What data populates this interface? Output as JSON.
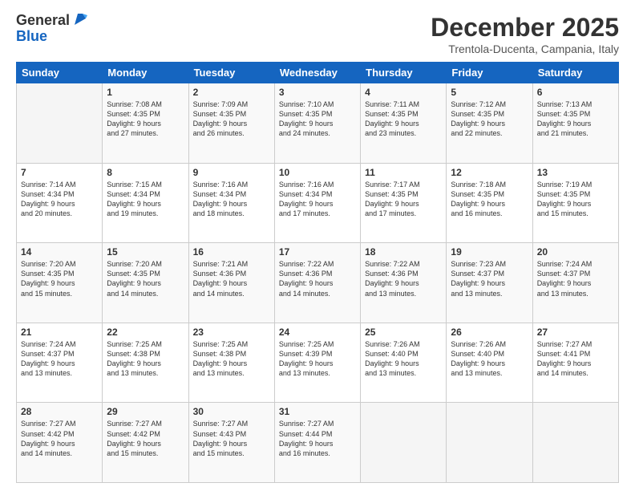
{
  "logo": {
    "general": "General",
    "blue": "Blue"
  },
  "title": "December 2025",
  "subtitle": "Trentola-Ducenta, Campania, Italy",
  "days": [
    "Sunday",
    "Monday",
    "Tuesday",
    "Wednesday",
    "Thursday",
    "Friday",
    "Saturday"
  ],
  "weeks": [
    [
      {
        "day": "",
        "content": ""
      },
      {
        "day": "1",
        "content": "Sunrise: 7:08 AM\nSunset: 4:35 PM\nDaylight: 9 hours\nand 27 minutes."
      },
      {
        "day": "2",
        "content": "Sunrise: 7:09 AM\nSunset: 4:35 PM\nDaylight: 9 hours\nand 26 minutes."
      },
      {
        "day": "3",
        "content": "Sunrise: 7:10 AM\nSunset: 4:35 PM\nDaylight: 9 hours\nand 24 minutes."
      },
      {
        "day": "4",
        "content": "Sunrise: 7:11 AM\nSunset: 4:35 PM\nDaylight: 9 hours\nand 23 minutes."
      },
      {
        "day": "5",
        "content": "Sunrise: 7:12 AM\nSunset: 4:35 PM\nDaylight: 9 hours\nand 22 minutes."
      },
      {
        "day": "6",
        "content": "Sunrise: 7:13 AM\nSunset: 4:35 PM\nDaylight: 9 hours\nand 21 minutes."
      }
    ],
    [
      {
        "day": "7",
        "content": "Sunrise: 7:14 AM\nSunset: 4:34 PM\nDaylight: 9 hours\nand 20 minutes."
      },
      {
        "day": "8",
        "content": "Sunrise: 7:15 AM\nSunset: 4:34 PM\nDaylight: 9 hours\nand 19 minutes."
      },
      {
        "day": "9",
        "content": "Sunrise: 7:16 AM\nSunset: 4:34 PM\nDaylight: 9 hours\nand 18 minutes."
      },
      {
        "day": "10",
        "content": "Sunrise: 7:16 AM\nSunset: 4:34 PM\nDaylight: 9 hours\nand 17 minutes."
      },
      {
        "day": "11",
        "content": "Sunrise: 7:17 AM\nSunset: 4:35 PM\nDaylight: 9 hours\nand 17 minutes."
      },
      {
        "day": "12",
        "content": "Sunrise: 7:18 AM\nSunset: 4:35 PM\nDaylight: 9 hours\nand 16 minutes."
      },
      {
        "day": "13",
        "content": "Sunrise: 7:19 AM\nSunset: 4:35 PM\nDaylight: 9 hours\nand 15 minutes."
      }
    ],
    [
      {
        "day": "14",
        "content": "Sunrise: 7:20 AM\nSunset: 4:35 PM\nDaylight: 9 hours\nand 15 minutes."
      },
      {
        "day": "15",
        "content": "Sunrise: 7:20 AM\nSunset: 4:35 PM\nDaylight: 9 hours\nand 14 minutes."
      },
      {
        "day": "16",
        "content": "Sunrise: 7:21 AM\nSunset: 4:36 PM\nDaylight: 9 hours\nand 14 minutes."
      },
      {
        "day": "17",
        "content": "Sunrise: 7:22 AM\nSunset: 4:36 PM\nDaylight: 9 hours\nand 14 minutes."
      },
      {
        "day": "18",
        "content": "Sunrise: 7:22 AM\nSunset: 4:36 PM\nDaylight: 9 hours\nand 13 minutes."
      },
      {
        "day": "19",
        "content": "Sunrise: 7:23 AM\nSunset: 4:37 PM\nDaylight: 9 hours\nand 13 minutes."
      },
      {
        "day": "20",
        "content": "Sunrise: 7:24 AM\nSunset: 4:37 PM\nDaylight: 9 hours\nand 13 minutes."
      }
    ],
    [
      {
        "day": "21",
        "content": "Sunrise: 7:24 AM\nSunset: 4:37 PM\nDaylight: 9 hours\nand 13 minutes."
      },
      {
        "day": "22",
        "content": "Sunrise: 7:25 AM\nSunset: 4:38 PM\nDaylight: 9 hours\nand 13 minutes."
      },
      {
        "day": "23",
        "content": "Sunrise: 7:25 AM\nSunset: 4:38 PM\nDaylight: 9 hours\nand 13 minutes."
      },
      {
        "day": "24",
        "content": "Sunrise: 7:25 AM\nSunset: 4:39 PM\nDaylight: 9 hours\nand 13 minutes."
      },
      {
        "day": "25",
        "content": "Sunrise: 7:26 AM\nSunset: 4:40 PM\nDaylight: 9 hours\nand 13 minutes."
      },
      {
        "day": "26",
        "content": "Sunrise: 7:26 AM\nSunset: 4:40 PM\nDaylight: 9 hours\nand 13 minutes."
      },
      {
        "day": "27",
        "content": "Sunrise: 7:27 AM\nSunset: 4:41 PM\nDaylight: 9 hours\nand 14 minutes."
      }
    ],
    [
      {
        "day": "28",
        "content": "Sunrise: 7:27 AM\nSunset: 4:42 PM\nDaylight: 9 hours\nand 14 minutes."
      },
      {
        "day": "29",
        "content": "Sunrise: 7:27 AM\nSunset: 4:42 PM\nDaylight: 9 hours\nand 15 minutes."
      },
      {
        "day": "30",
        "content": "Sunrise: 7:27 AM\nSunset: 4:43 PM\nDaylight: 9 hours\nand 15 minutes."
      },
      {
        "day": "31",
        "content": "Sunrise: 7:27 AM\nSunset: 4:44 PM\nDaylight: 9 hours\nand 16 minutes."
      },
      {
        "day": "",
        "content": ""
      },
      {
        "day": "",
        "content": ""
      },
      {
        "day": "",
        "content": ""
      }
    ]
  ]
}
